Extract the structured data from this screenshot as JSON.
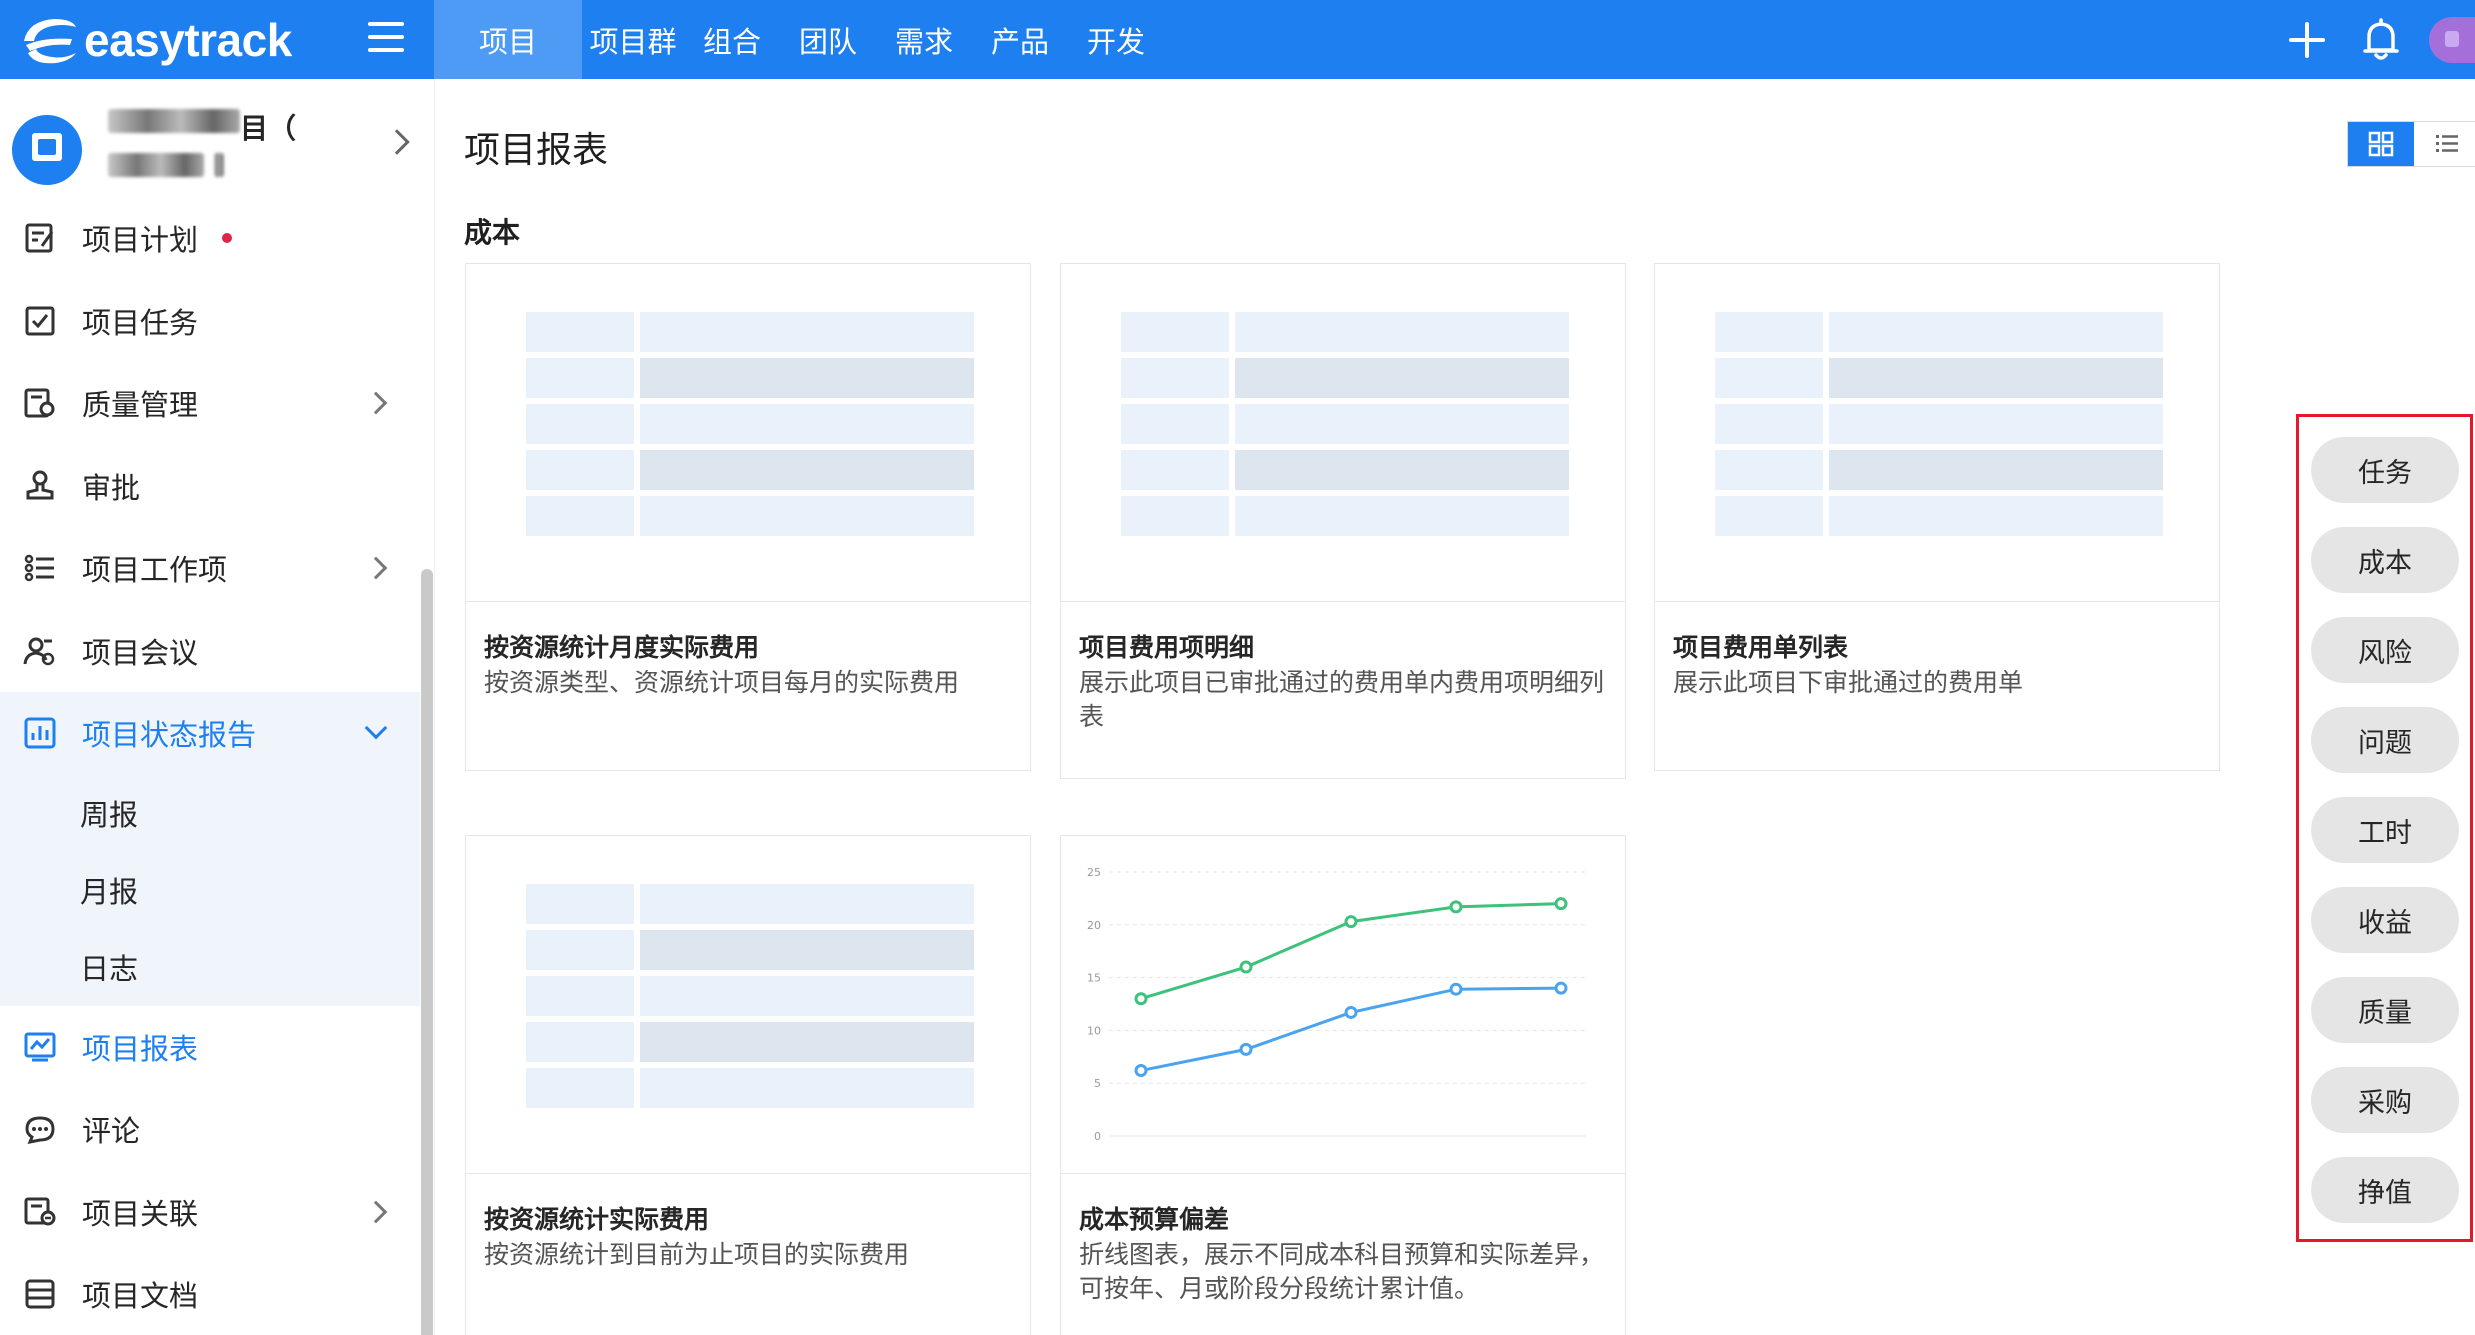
{
  "brand": {
    "name": "easytrack"
  },
  "nav": {
    "items": [
      {
        "label": "项目",
        "active": true
      },
      {
        "label": "项目群",
        "active": false
      },
      {
        "label": "组合",
        "active": false
      },
      {
        "label": "团队",
        "active": false
      },
      {
        "label": "需求",
        "active": false
      },
      {
        "label": "产品",
        "active": false
      },
      {
        "label": "开发",
        "active": false
      }
    ]
  },
  "project": {
    "name_suffix": "目（"
  },
  "sidebar": {
    "items": [
      {
        "label": "项目计划",
        "icon": "plan-icon"
      },
      {
        "label": "项目任务",
        "icon": "task-checkbox-icon"
      },
      {
        "label": "质量管理",
        "icon": "quality-icon"
      },
      {
        "label": "审批",
        "icon": "approval-stamp-icon"
      },
      {
        "label": "项目工作项",
        "icon": "list-icon"
      },
      {
        "label": "项目会议",
        "icon": "meeting-icon"
      },
      {
        "label": "项目状态报告",
        "icon": "report-chart-icon"
      },
      {
        "label": "项目报表",
        "icon": "line-chart-icon"
      },
      {
        "label": "评论",
        "icon": "comment-icon"
      },
      {
        "label": "项目关联",
        "icon": "link-icon"
      },
      {
        "label": "项目文档",
        "icon": "document-icon"
      }
    ],
    "status_report_sub": [
      "周报",
      "月报",
      "日志"
    ]
  },
  "main": {
    "title": "项目报表",
    "section": "成本",
    "cards": [
      {
        "title": "按资源统计月度实际费用",
        "desc": "按资源类型、资源统计项目每月的实际费用"
      },
      {
        "title": "项目费用项明细",
        "desc": "展示此项目已审批通过的费用单内费用项明细列表"
      },
      {
        "title": "项目费用单列表",
        "desc": "展示此项目下审批通过的费用单"
      },
      {
        "title": "按资源统计实际费用",
        "desc": "按资源统计到目前为止项目的实际费用"
      },
      {
        "title": "成本预算偏差",
        "desc": "折线图表，展示不同成本科目预算和实际差异，可按年、月或阶段分段统计累计值。"
      }
    ]
  },
  "categories": [
    "任务",
    "成本",
    "风险",
    "问题",
    "工时",
    "收益",
    "质量",
    "采购",
    "挣值"
  ],
  "chart_data": {
    "type": "line",
    "x": [
      1,
      2,
      3,
      4,
      5
    ],
    "ylim": [
      0,
      25
    ],
    "yticks": [
      "0",
      "5",
      "10",
      "15",
      "20",
      "25"
    ],
    "series": [
      {
        "values": [
          13,
          16,
          20.3,
          21.7,
          22
        ],
        "color": "#3cc27a"
      },
      {
        "values": [
          6.2,
          8.2,
          11.7,
          13.9,
          14
        ],
        "color": "#49a3ef"
      }
    ]
  },
  "colors": {
    "primary": "#1d7ff0",
    "highlight_border": "#e5182b"
  }
}
